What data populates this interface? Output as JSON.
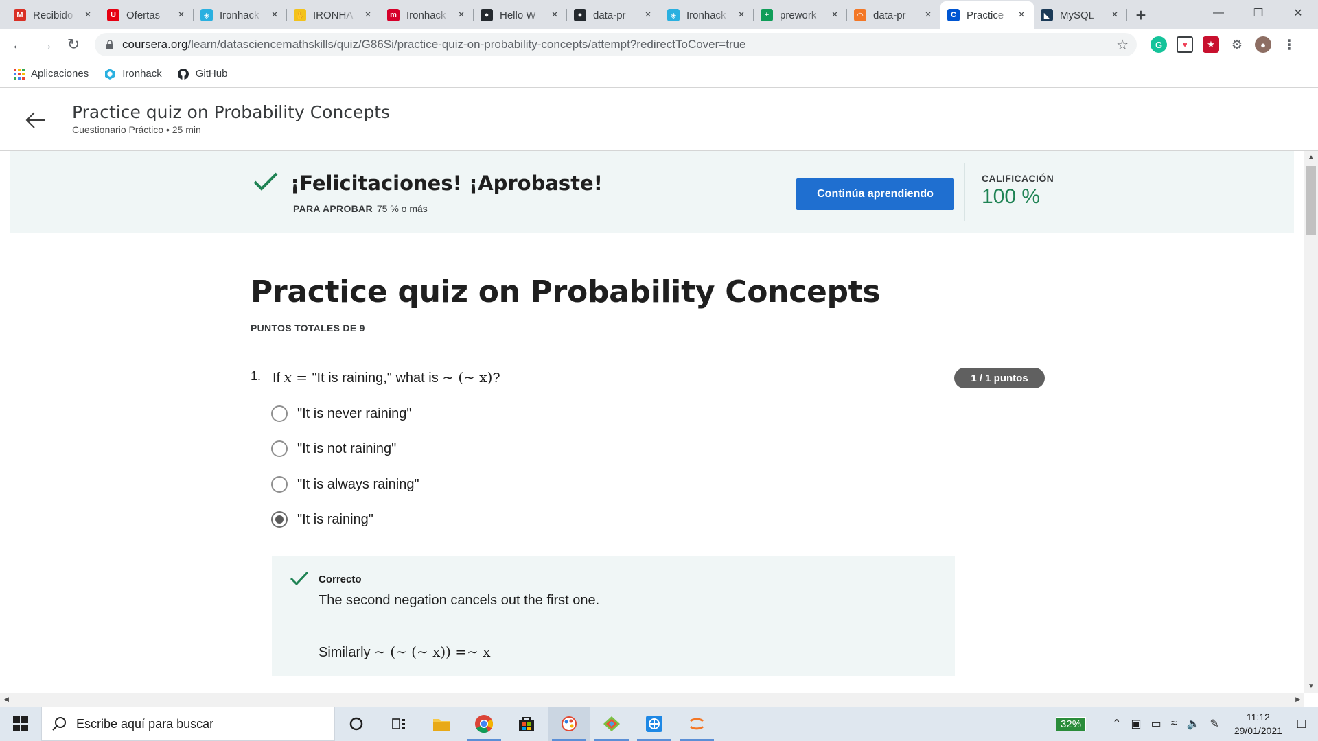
{
  "browser": {
    "tabs": [
      {
        "label": "Recibido",
        "icon": "gmail-icon",
        "color": "#d93025",
        "glyph": "M",
        "active": false
      },
      {
        "label": "Ofertas",
        "icon": "uniqlo-icon",
        "color": "#e60012",
        "glyph": "U",
        "active": false
      },
      {
        "label": "Ironhack",
        "icon": "ironhack-icon",
        "color": "#2ab0e0",
        "glyph": "◈",
        "active": false
      },
      {
        "label": "IRONHA",
        "icon": "hand-icon",
        "color": "#f2c21b",
        "glyph": "✋",
        "active": false
      },
      {
        "label": "Ironhack",
        "icon": "m-icon",
        "color": "#d6002a",
        "glyph": "m",
        "active": false
      },
      {
        "label": "Hello W",
        "icon": "github-icon",
        "color": "#24292e",
        "glyph": "●",
        "active": false
      },
      {
        "label": "data-pr",
        "icon": "github-icon",
        "color": "#24292e",
        "glyph": "●",
        "active": false
      },
      {
        "label": "Ironhack",
        "icon": "ironhack-icon",
        "color": "#2ab0e0",
        "glyph": "◈",
        "active": false
      },
      {
        "label": "prework",
        "icon": "sheets-icon",
        "color": "#0f9d58",
        "glyph": "+",
        "active": false
      },
      {
        "label": "data-pr",
        "icon": "jupyter-icon",
        "color": "#f37726",
        "glyph": "◠",
        "active": false
      },
      {
        "label": "Practice",
        "icon": "coursera-icon",
        "color": "#0056d2",
        "glyph": "C",
        "active": true
      },
      {
        "label": "MySQL",
        "icon": "mysql-icon",
        "color": "#1b3a57",
        "glyph": "◣",
        "active": false
      }
    ],
    "url_host": "coursera.org",
    "url_path": "/learn/datasciencemathskills/quiz/G86Si/practice-quiz-on-probability-concepts/attempt?redirectToCover=true",
    "bookmarks": [
      {
        "label": "Aplicaciones",
        "icon": "apps-grid-icon"
      },
      {
        "label": "Ironhack",
        "icon": "ironhack-icon"
      },
      {
        "label": "GitHub",
        "icon": "github-icon"
      }
    ]
  },
  "header": {
    "title": "Practice quiz on Probability Concepts",
    "subtitle": "Cuestionario Práctico • 25 min"
  },
  "banner": {
    "headline": "¡Felicitaciones! ¡Aprobaste!",
    "pass_label": "PARA APROBAR",
    "pass_value": "75 % o más",
    "button_label": "Continúa aprendiendo",
    "grade_label": "CALIFICACIÓN",
    "grade_value": "100 %",
    "accent_color": "#1f6fd0",
    "success_color": "#1f8354"
  },
  "quiz": {
    "title": "Practice quiz on Probability Concepts",
    "points_total": "PUNTOS TOTALES DE 9",
    "question": {
      "number": "1.",
      "text_prefix": "If ",
      "math_x": "x",
      "text_equals": " = ",
      "text_quote": "\"It is raining,\" what is ",
      "math_expr": "∼ (∼ x)",
      "text_suffix": "?",
      "score_badge": "1 / 1 puntos",
      "options": [
        {
          "label": "\"It is never raining\"",
          "selected": false
        },
        {
          "label": "\"It is not raining\"",
          "selected": false
        },
        {
          "label": "\"It is always raining\"",
          "selected": false
        },
        {
          "label": "\"It is raining\"",
          "selected": true
        }
      ],
      "feedback": {
        "status": "Correcto",
        "explanation": "The second negation cancels out the first one.",
        "similarly_prefix": "Similarly ",
        "similarly_expr": "∼ (∼ (∼ x)) =∼ x"
      }
    }
  },
  "taskbar": {
    "search_placeholder": "Escribe aquí para buscar",
    "battery": "32%",
    "time": "11:12",
    "date": "29/01/2021"
  }
}
